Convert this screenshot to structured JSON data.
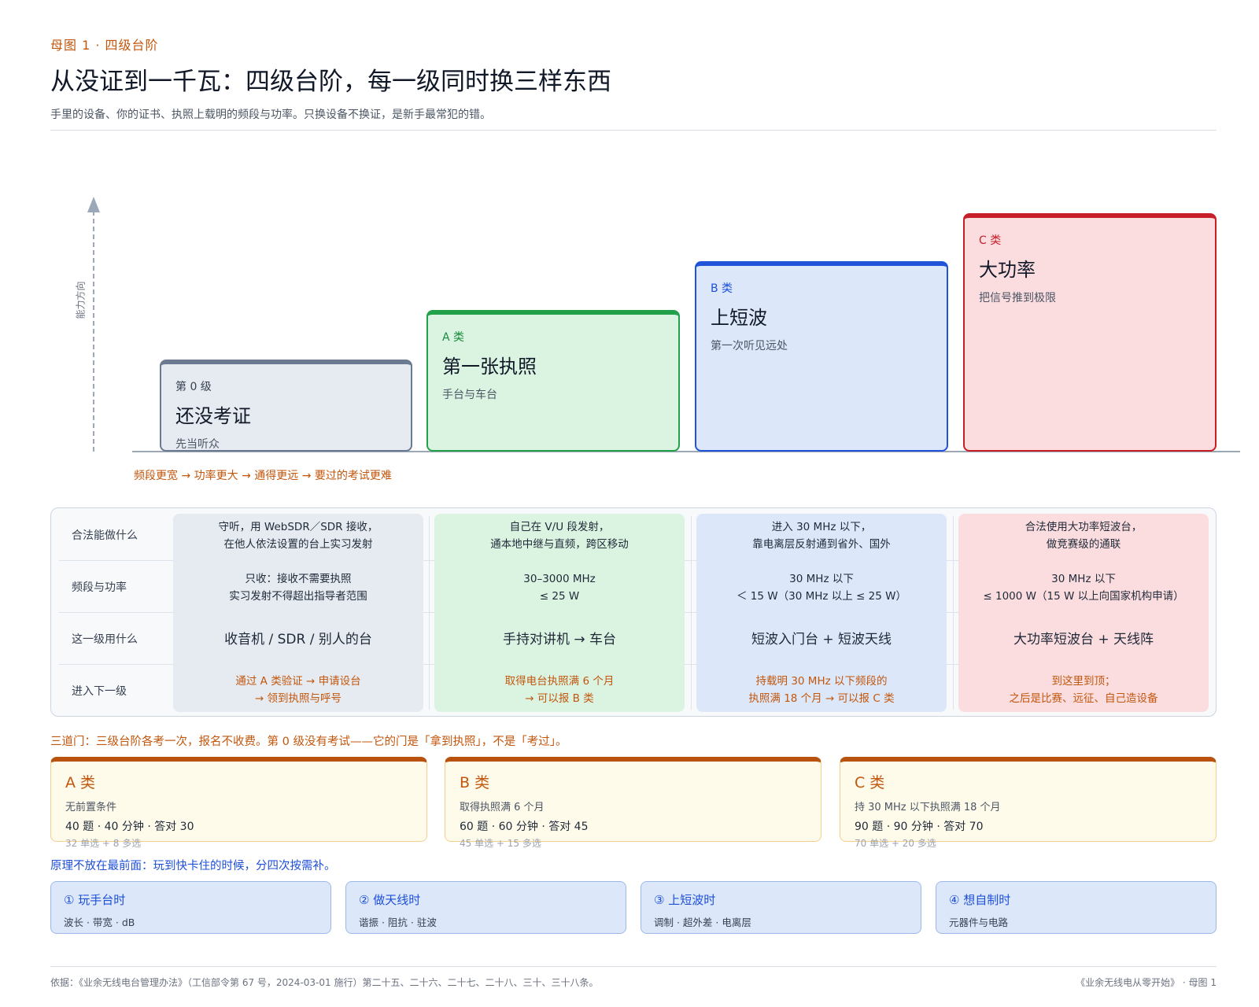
{
  "header": {
    "kicker": "母图 1 · 四级台阶",
    "title": "从没证到一千瓦：四级台阶，每一级同时换三样东西",
    "subtitle": "手里的设备、你的证书、执照上载明的频段与功率。只换设备不换证，是新手最常犯的错。"
  },
  "stairs": {
    "axis_label": "能力方向",
    "caption": "频段更宽 → 功率更大 → 通得更远 → 要过的考试更难",
    "steps": [
      {
        "level": "第 0 级",
        "name": "还没考证",
        "tagline": "先当听众"
      },
      {
        "level": "A 类",
        "name": "第一张执照",
        "tagline": "手台与车台"
      },
      {
        "level": "B 类",
        "name": "上短波",
        "tagline": "第一次听见远处"
      },
      {
        "level": "C 类",
        "name": "大功率",
        "tagline": "把信号推到极限"
      }
    ]
  },
  "table": {
    "row_labels": [
      "合法能做什么",
      "频段与功率",
      "这一级用什么",
      "进入下一级"
    ],
    "columns": [
      {
        "can_do_1": "守听，用 WebSDR／SDR 接收，",
        "can_do_2": "在他人依法设置的台上实习发射",
        "band_1": "只收：接收不需要执照",
        "band_2": "实习发射不得超出指导者范围",
        "equipment": "收音机 / SDR / 别人的台",
        "next_1": "通过 A 类验证 → 申请设台",
        "next_2": "→ 领到执照与呼号"
      },
      {
        "can_do_1": "自己在 V/U 段发射，",
        "can_do_2": "通本地中继与直频，跨区移动",
        "band_1": "30–3000 MHz",
        "band_2": "≤ 25 W",
        "equipment": "手持对讲机 → 车台",
        "next_1": "取得电台执照满 6 个月",
        "next_2": "→ 可以报 B 类"
      },
      {
        "can_do_1": "进入 30 MHz 以下，",
        "can_do_2": "靠电离层反射通到省外、国外",
        "band_1": "30 MHz 以下",
        "band_2": "＜ 15 W（30 MHz 以上 ≤ 25 W）",
        "equipment": "短波入门台 + 短波天线",
        "next_1": "持载明 30 MHz 以下频段的",
        "next_2": "执照满 18 个月 → 可以报 C 类"
      },
      {
        "can_do_1": "合法使用大功率短波台，",
        "can_do_2": "做竞赛级的通联",
        "band_1": "30 MHz 以下",
        "band_2": "≤ 1000 W（15 W 以上向国家机构申请）",
        "equipment": "大功率短波台 + 天线阵",
        "next_1": "到这里到顶；",
        "next_2": "之后是比赛、远征、自己造设备"
      }
    ]
  },
  "exams": {
    "intro": "三道门：三级台阶各考一次，报名不收费。第 0 级没有考试——它的门是「拿到执照」，不是「考过」。",
    "items": [
      {
        "name": "A 类",
        "prereq": "无前置条件",
        "spec": "40 题 · 40 分钟 · 答对 30",
        "mix": "32 单选 + 8 多选"
      },
      {
        "name": "B 类",
        "prereq": "取得执照满 6 个月",
        "spec": "60 题 · 60 分钟 · 答对 45",
        "mix": "45 单选 + 15 多选"
      },
      {
        "name": "C 类",
        "prereq": "持 30 MHz 以下执照满 18 个月",
        "spec": "90 题 · 90 分钟 · 答对 70",
        "mix": "70 单选 + 20 多选"
      }
    ]
  },
  "theory": {
    "intro": "原理不放在最前面：玩到快卡住的时候，分四次按需补。",
    "items": [
      {
        "name": "① 玩手台时",
        "topics": "波长 · 带宽 · dB"
      },
      {
        "name": "② 做天线时",
        "topics": "谐振 · 阻抗 · 驻波"
      },
      {
        "name": "③ 上短波时",
        "topics": "调制 · 超外差 · 电离层"
      },
      {
        "name": "④ 想自制时",
        "topics": "元器件与电路"
      }
    ]
  },
  "footer": {
    "source": "依据：《业余无线电台管理办法》（工信部令第 67 号，2024-03-01 施行）第二十五、二十六、二十七、二十八、三十、三十八条。",
    "book": "《业余无线电从零开始》 · 母图 1"
  }
}
